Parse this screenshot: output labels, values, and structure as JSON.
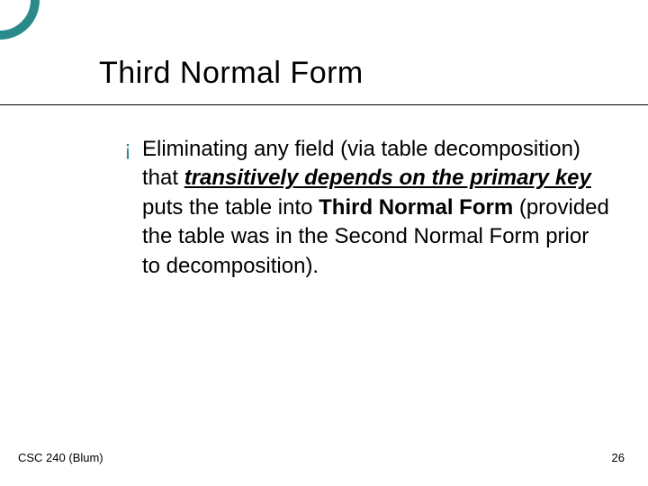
{
  "slide": {
    "title": "Third Normal Form",
    "bullet": {
      "marker": "¡",
      "part1": "Eliminating any field (via table decomposition) that ",
      "emphasis": "transitively depends on the primary key ",
      "part2": "puts the table into ",
      "bold": "Third Normal Form",
      "part3": " (provided the table was in the Second  Normal Form prior to decomposition)."
    }
  },
  "footer": {
    "left": "CSC 240 (Blum)",
    "right": "26"
  }
}
